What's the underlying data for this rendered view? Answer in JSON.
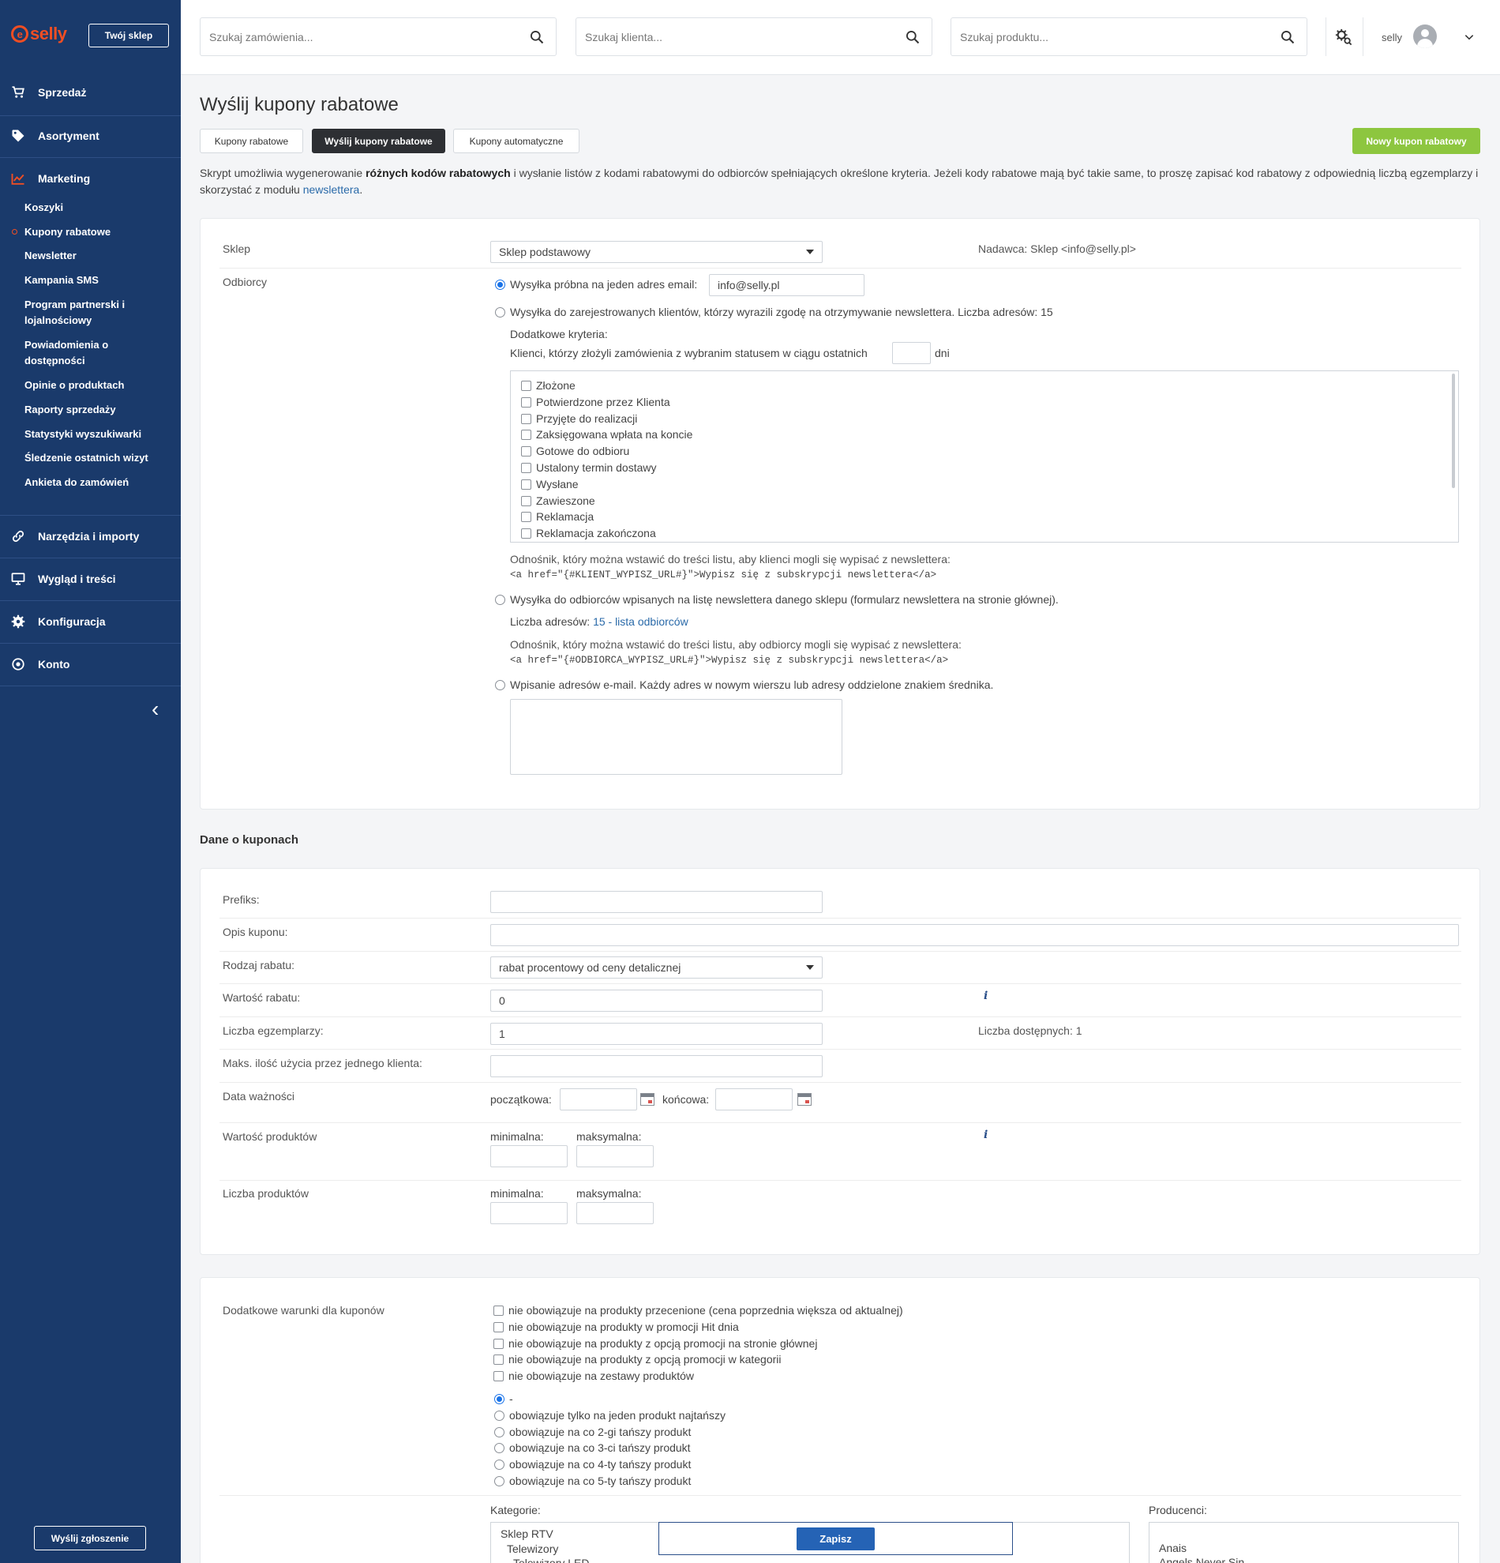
{
  "sidebar": {
    "logo_text": "selly",
    "shop_button": "Twój sklep",
    "nav": [
      {
        "label": "Sprzedaż",
        "icon": "cart-icon"
      },
      {
        "label": "Asortyment",
        "icon": "tag-icon"
      },
      {
        "label": "Marketing",
        "icon": "chart-icon"
      },
      {
        "label": "Narzędzia i importy",
        "icon": "link-icon"
      },
      {
        "label": "Wygląd i treści",
        "icon": "monitor-icon"
      },
      {
        "label": "Konfiguracja",
        "icon": "gear-icon"
      },
      {
        "label": "Konto",
        "icon": "account-icon"
      }
    ],
    "marketing_sub": [
      "Koszyki",
      "Kupony rabatowe",
      "Newsletter",
      "Kampania SMS",
      "Program partnerski i lojalnościowy",
      "Powiadomienia o dostępności",
      "Opinie o produktach",
      "Raporty sprzedaży",
      "Statystyki wyszukiwarki",
      "Śledzenie ostatnich wizyt",
      "Ankieta do zamówień"
    ],
    "report_button": "Wyślij zgłoszenie"
  },
  "topbar": {
    "search_orders": "Szukaj zamówienia...",
    "search_clients": "Szukaj klienta...",
    "search_products": "Szukaj produktu...",
    "user": "selly"
  },
  "page": {
    "title": "Wyślij kupony rabatowe",
    "tabs": [
      "Kupony rabatowe",
      "Wyślij kupony rabatowe",
      "Kupony automatyczne"
    ],
    "new_button": "Nowy kupon rabatowy",
    "intro_1": "Skrypt umożliwia wygenerowanie ",
    "intro_bold": "różnych kodów rabatowych",
    "intro_2": " i wysłanie listów z kodami rabatowymi do odbiorców spełniających określone kryteria. Jeżeli kody rabatowe mają być takie same, to proszę zapisać kod rabatowy z odpowiednią liczbą egzemplarzy i skorzystać z modułu ",
    "intro_link": "newslettera",
    "intro_end": "."
  },
  "recipients": {
    "shop_label": "Sklep",
    "shop_value": "Sklep podstawowy",
    "sender": "Nadawca: Sklep <info@selly.pl>",
    "recipients_label": "Odbiorcy",
    "opt_test": "Wysyłka próbna na jeden adres email:",
    "test_email": "info@selly.pl",
    "opt_registered": "Wysyłka do zarejestrowanych klientów, którzy wyrazili zgodę na otrzymywanie newslettera. Liczba adresów: 15",
    "extra_criteria": "Dodatkowe kryteria:",
    "orders_criteria": "Klienci, którzy złożyli zamówienia z wybranim statusem w ciągu ostatnich",
    "days": "dni",
    "statuses": [
      "Złożone",
      "Potwierdzone przez Klienta",
      "Przyjęte do realizacji",
      "Zaksięgowana wpłata na koncie",
      "Gotowe do odbioru",
      "Ustalony termin dostawy",
      "Wysłane",
      "Zawieszone",
      "Reklamacja",
      "Reklamacja zakończona"
    ],
    "unsub_note_1": "Odnośnik, który można wstawić do treści listu, aby klienci mogli się wypisać z newslettera:",
    "unsub_code_1": "<a href=\"{#KLIENT_WYPISZ_URL#}\">Wypisz się z subskrypcji newslettera</a>",
    "opt_newsletter": "Wysyłka do odbiorców wpisanych na listę newslettera danego sklepu (formularz newslettera na stronie głównej).",
    "addr_count_label": "Liczba adresów: ",
    "addr_count_link": "15 - lista odbiorców",
    "unsub_note_2": "Odnośnik, który można wstawić do treści listu, aby odbiorcy mogli się wypisać z newslettera:",
    "unsub_code_2": "<a href=\"{#ODBIORCA_WYPISZ_URL#}\">Wypisz się z subskrypcji newslettera</a>",
    "opt_manual": "Wpisanie adresów e-mail. Każdy adres w nowym wierszu lub adresy oddzielone znakiem średnika."
  },
  "coupons": {
    "section_title": "Dane o kuponach",
    "prefix_label": "Prefiks:",
    "desc_label": "Opis kuponu:",
    "type_label": "Rodzaj rabatu:",
    "type_value": "rabat procentowy od ceny detalicznej",
    "value_label": "Wartość rabatu:",
    "value_value": "0",
    "count_label": "Liczba egzemplarzy:",
    "count_value": "1",
    "available": "Liczba dostępnych: 1",
    "max_label": "Maks. ilość użycia przez jednego klienta:",
    "validity_label": "Data ważności",
    "start_label": "początkowa:",
    "end_label": "końcowa:",
    "prod_value_label": "Wartość produktów",
    "prod_count_label": "Liczba produktów",
    "min_label": "minimalna:",
    "max_range_label": "maksymalna:",
    "info_glyph": "i"
  },
  "conditions": {
    "label": "Dodatkowe warunki dla kuponów",
    "checks": [
      "nie obowiązuje na produkty przecenione (cena poprzednia większa od aktualnej)",
      "nie obowiązuje na produkty w promocji Hit dnia",
      "nie obowiązuje na produkty z opcją promocji na stronie głównej",
      "nie obowiązuje na produkty z opcją promocji w kategorii",
      "nie obowiązuje na zestawy produktów"
    ],
    "radios": [
      "-",
      "obowiązuje tylko na jeden produkt najtańszy",
      "obowiązuje na co 2-gi tańszy produkt",
      "obowiązuje na co 3-ci tańszy produkt",
      "obowiązuje na co 4-ty tańszy produkt",
      "obowiązuje na co 5-ty tańszy produkt"
    ],
    "categories_label": "Kategorie:",
    "categories": [
      "Sklep RTV",
      "Telewizory",
      "Telewizory LED"
    ],
    "producers_label": "Producenci:",
    "producers": [
      "Anais",
      "Angels Never Sin"
    ],
    "save_button": "Zapisz"
  }
}
